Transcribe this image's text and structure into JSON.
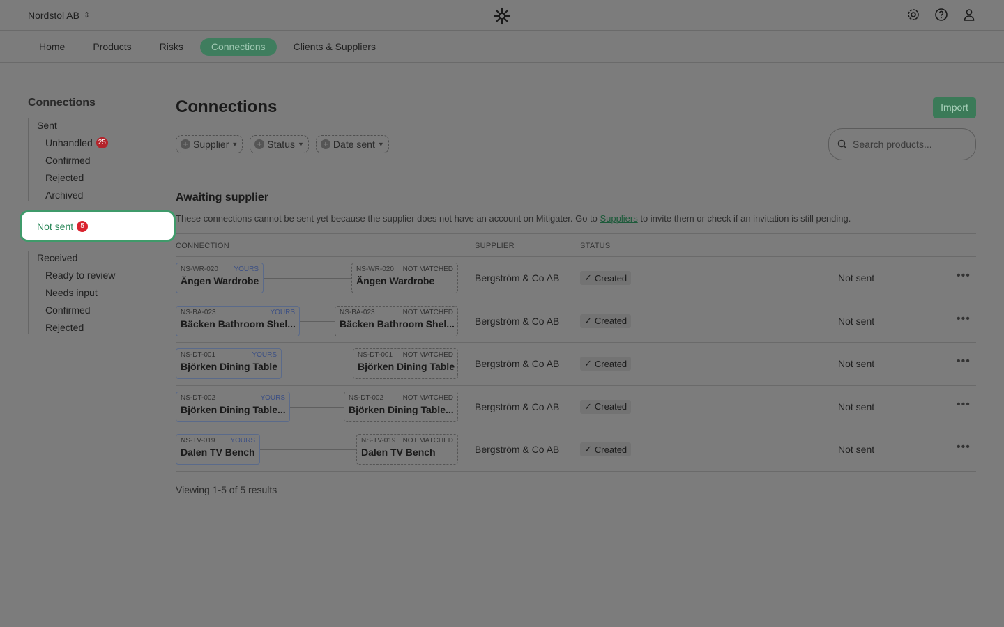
{
  "org": {
    "name": "Nordstol AB"
  },
  "nav": {
    "items": [
      "Home",
      "Products",
      "Risks",
      "Connections",
      "Clients & Suppliers"
    ],
    "active": "Connections"
  },
  "sidebar": {
    "title": "Connections",
    "sent_label": "Sent",
    "sent_items": [
      {
        "label": "Unhandled",
        "badge": "25"
      },
      {
        "label": "Confirmed"
      },
      {
        "label": "Rejected"
      },
      {
        "label": "Archived"
      }
    ],
    "not_sent": {
      "label": "Not sent",
      "badge": "5"
    },
    "received_label": "Received",
    "received_items": [
      "Ready to review",
      "Needs input",
      "Confirmed",
      "Rejected"
    ]
  },
  "main": {
    "title": "Connections",
    "import_label": "Import",
    "filters": [
      "Supplier",
      "Status",
      "Date sent"
    ],
    "search_placeholder": "Search products...",
    "section_title": "Awaiting supplier",
    "desc_before": "These connections cannot be sent yet because the supplier does not have an account on Mitigater. Go to ",
    "desc_link": "Suppliers",
    "desc_after": " to invite them or check if an invitation is still pending.",
    "columns": {
      "connection": "CONNECTION",
      "supplier": "SUPPLIER",
      "status": "STATUS"
    },
    "rows": [
      {
        "code": "NS-WR-020",
        "tag": "YOURS",
        "name": "Ängen Wardrobe",
        "their_code": "NS-WR-020",
        "their_tag": "NOT MATCHED",
        "their_name": "Ängen Wardrobe",
        "supplier": "Bergström & Co AB",
        "status": "Created",
        "sent": "Not sent"
      },
      {
        "code": "NS-BA-023",
        "tag": "YOURS",
        "name": "Bäcken Bathroom Shel...",
        "their_code": "NS-BA-023",
        "their_tag": "NOT MATCHED",
        "their_name": "Bäcken Bathroom Shel...",
        "supplier": "Bergström & Co AB",
        "status": "Created",
        "sent": "Not sent"
      },
      {
        "code": "NS-DT-001",
        "tag": "YOURS",
        "name": "Björken Dining Table",
        "their_code": "NS-DT-001",
        "their_tag": "NOT MATCHED",
        "their_name": "Björken Dining Table",
        "supplier": "Bergström & Co AB",
        "status": "Created",
        "sent": "Not sent"
      },
      {
        "code": "NS-DT-002",
        "tag": "YOURS",
        "name": "Björken Dining Table...",
        "their_code": "NS-DT-002",
        "their_tag": "NOT MATCHED",
        "their_name": "Björken Dining Table...",
        "supplier": "Bergström & Co AB",
        "status": "Created",
        "sent": "Not sent"
      },
      {
        "code": "NS-TV-019",
        "tag": "YOURS",
        "name": "Dalen TV Bench",
        "their_code": "NS-TV-019",
        "their_tag": "NOT MATCHED",
        "their_name": "Dalen TV Bench",
        "supplier": "Bergström & Co AB",
        "status": "Created",
        "sent": "Not sent"
      }
    ],
    "results_text": "Viewing 1-5 of 5 results"
  },
  "colors": {
    "accent": "#3f9a6a",
    "badge": "#d9232e",
    "overlay_bg": "#7c7c7c"
  },
  "icons": {
    "top": [
      "gear-icon",
      "help-icon",
      "user-icon"
    ]
  }
}
